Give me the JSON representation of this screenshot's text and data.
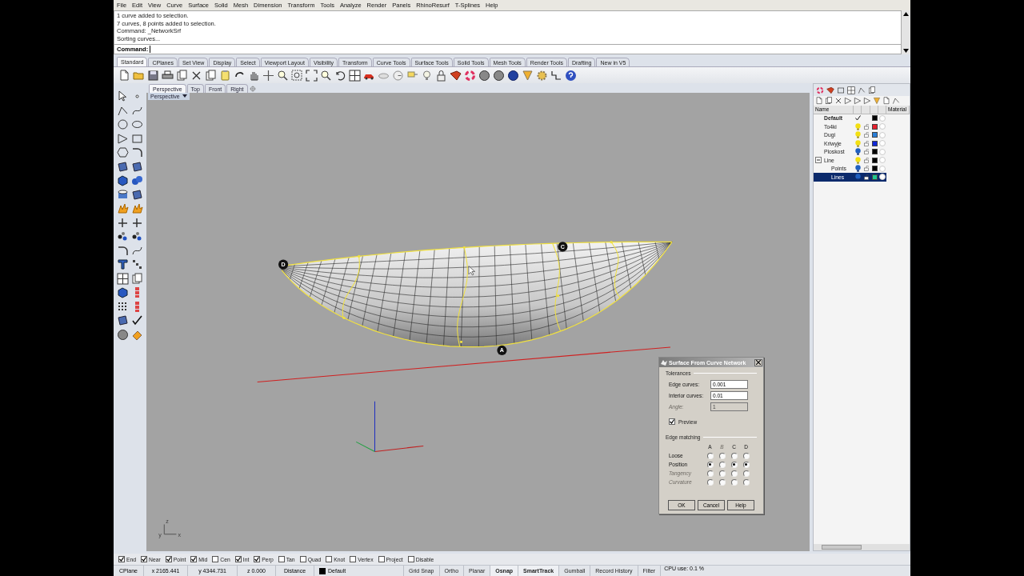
{
  "menu": [
    "File",
    "Edit",
    "View",
    "Curve",
    "Surface",
    "Solid",
    "Mesh",
    "Dimension",
    "Transform",
    "Tools",
    "Analyze",
    "Render",
    "Panels",
    "RhinoResurf",
    "T-Splines",
    "Help"
  ],
  "command_history": [
    "1 curve added to selection.",
    "7 curves, 8 points added to selection.",
    "Command: _NetworkSrf",
    "Sorting curves..."
  ],
  "command_prompt": {
    "label": "Command:"
  },
  "toolbar_tabs": [
    {
      "label": "Standard",
      "selected": true
    },
    {
      "label": "CPlanes",
      "selected": false
    },
    {
      "label": "Set View",
      "selected": false
    },
    {
      "label": "Display",
      "selected": false
    },
    {
      "label": "Select",
      "selected": false
    },
    {
      "label": "Viewport Layout",
      "selected": false
    },
    {
      "label": "Visibility",
      "selected": false
    },
    {
      "label": "Transform",
      "selected": false
    },
    {
      "label": "Curve Tools",
      "selected": false
    },
    {
      "label": "Surface Tools",
      "selected": false
    },
    {
      "label": "Solid Tools",
      "selected": false
    },
    {
      "label": "Mesh Tools",
      "selected": false
    },
    {
      "label": "Render Tools",
      "selected": false
    },
    {
      "label": "Drafting",
      "selected": false
    },
    {
      "label": "New in V5",
      "selected": false
    }
  ],
  "viewport_tabs": [
    {
      "label": "Perspective",
      "selected": true
    },
    {
      "label": "Top",
      "selected": false
    },
    {
      "label": "Front",
      "selected": false
    },
    {
      "label": "Right",
      "selected": false
    }
  ],
  "viewport": {
    "title": "Perspective",
    "markers": [
      {
        "label": "D"
      },
      {
        "label": "C"
      },
      {
        "label": "A"
      }
    ],
    "axis_labels": [
      "z",
      "y",
      "x"
    ]
  },
  "dialog": {
    "title": "Surface From Curve Network",
    "tolerances": {
      "title": "Tolerances",
      "fields": [
        {
          "label": "Edge curves:",
          "value": "0.001",
          "disabled": false
        },
        {
          "label": "Interior curves:",
          "value": "0.01",
          "disabled": false
        },
        {
          "label": "Angle:",
          "value": "1",
          "disabled": true
        }
      ]
    },
    "preview": {
      "label": "Preview",
      "checked": true
    },
    "edge_matching": {
      "title": "Edge matching",
      "columns": [
        {
          "label": "A",
          "disabled": false
        },
        {
          "label": "B",
          "disabled": true
        },
        {
          "label": "C",
          "disabled": false
        },
        {
          "label": "D",
          "disabled": false
        }
      ],
      "rows": [
        {
          "label": "Loose",
          "disabled": false,
          "options": [
            {
              "selected": false
            },
            {
              "selected": false
            },
            {
              "selected": false
            },
            {
              "selected": false
            }
          ]
        },
        {
          "label": "Position",
          "disabled": false,
          "options": [
            {
              "selected": true
            },
            {
              "selected": false
            },
            {
              "selected": true
            },
            {
              "selected": true
            }
          ]
        },
        {
          "label": "Tangency",
          "disabled": true,
          "options": [
            {
              "selected": false
            },
            {
              "selected": false
            },
            {
              "selected": false
            },
            {
              "selected": false
            }
          ]
        },
        {
          "label": "Curvature",
          "disabled": true,
          "options": [
            {
              "selected": false
            },
            {
              "selected": false
            },
            {
              "selected": false
            },
            {
              "selected": false
            }
          ]
        }
      ]
    },
    "buttons": [
      "OK",
      "Cancel",
      "Help"
    ]
  },
  "layers_panel": {
    "columns": [
      "Name",
      "Material"
    ],
    "layers": [
      {
        "name": "Default",
        "current": true,
        "color": "#000000",
        "selected": false
      },
      {
        "name": "To4ki",
        "current": false,
        "on": true,
        "color": "#e8202e",
        "selected": false
      },
      {
        "name": "Dugi",
        "current": false,
        "on": true,
        "color": "#2a7fd8",
        "selected": false
      },
      {
        "name": "Kriwyje",
        "current": false,
        "on": true,
        "color": "#1028d8",
        "selected": false
      },
      {
        "name": "Ploskost",
        "current": false,
        "on": false,
        "color": "#000000",
        "selected": false
      },
      {
        "name": "Line",
        "current": false,
        "on": true,
        "color": "#000000",
        "selected": false,
        "expanded": true,
        "children": [
          {
            "name": "Points",
            "current": false,
            "on": false,
            "color": "#000000",
            "selected": false
          },
          {
            "name": "Lines",
            "current": false,
            "on": false,
            "color": "#20c890",
            "selected": true
          }
        ]
      }
    ]
  },
  "osnaps": [
    {
      "label": "End",
      "checked": true
    },
    {
      "label": "Near",
      "checked": true
    },
    {
      "label": "Point",
      "checked": true
    },
    {
      "label": "Mid",
      "checked": true
    },
    {
      "label": "Cen",
      "checked": false
    },
    {
      "label": "Int",
      "checked": true
    },
    {
      "label": "Perp",
      "checked": true
    },
    {
      "label": "Tan",
      "checked": false
    },
    {
      "label": "Quad",
      "checked": false
    },
    {
      "label": "Knot",
      "checked": false
    },
    {
      "label": "Vertex",
      "checked": false
    },
    {
      "label": "Project",
      "checked": false
    },
    {
      "label": "Disable",
      "checked": false
    }
  ],
  "status_bar": {
    "cplane": "CPlane",
    "x": "x 2165.441",
    "y": "y 4344.731",
    "z": "z 0.000",
    "distance": "Distance",
    "layer": {
      "name": "Default",
      "color": "#000000"
    },
    "toggles": [
      {
        "label": "Grid Snap",
        "on": false
      },
      {
        "label": "Ortho",
        "on": false
      },
      {
        "label": "Planar",
        "on": false
      },
      {
        "label": "Osnap",
        "on": true
      },
      {
        "label": "SmartTrack",
        "on": true
      },
      {
        "label": "Gumball",
        "on": false
      },
      {
        "label": "Record History",
        "on": false
      },
      {
        "label": "Filter",
        "on": false
      }
    ],
    "cpu": "CPU use: 0.1 %"
  }
}
